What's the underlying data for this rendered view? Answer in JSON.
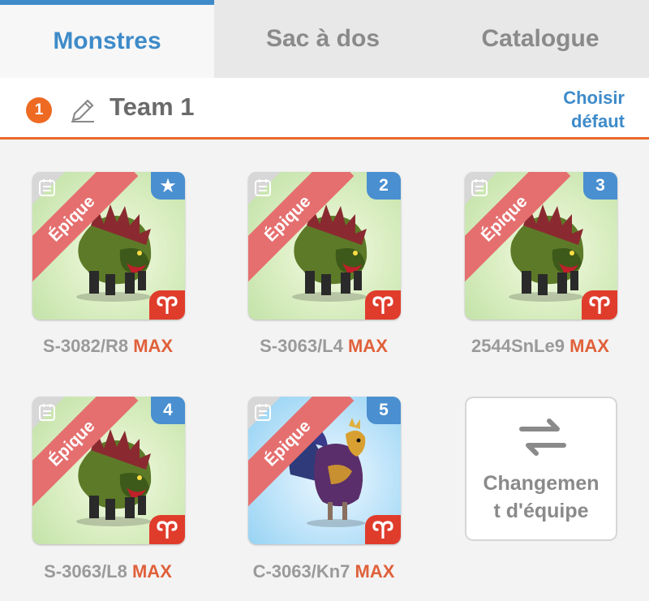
{
  "tabs": [
    {
      "label": "Monstres",
      "active": true
    },
    {
      "label": "Sac à dos",
      "active": false
    },
    {
      "label": "Catalogue",
      "active": false
    }
  ],
  "team": {
    "number": "1",
    "name": "Team 1",
    "choose_default": [
      "Choisir",
      "défaut"
    ]
  },
  "monsters": [
    {
      "rarity": "Épique",
      "slot": "★",
      "name": "S-3082/R8",
      "level": "MAX",
      "bg": "green",
      "kind": "dragon"
    },
    {
      "rarity": "Épique",
      "slot": "2",
      "name": "S-3063/L4",
      "level": "MAX",
      "bg": "green",
      "kind": "dragon"
    },
    {
      "rarity": "Épique",
      "slot": "3",
      "name": "2544SnLe9",
      "level": "MAX",
      "bg": "green",
      "kind": "dragon"
    },
    {
      "rarity": "Épique",
      "slot": "4",
      "name": "S-3063/L8",
      "level": "MAX",
      "bg": "green",
      "kind": "dragon"
    },
    {
      "rarity": "Épique",
      "slot": "5",
      "name": "C-3063/Kn7",
      "level": "MAX",
      "bg": "blue",
      "kind": "rooster"
    }
  ],
  "swap": {
    "label_lines": [
      "Changemen",
      "t d'équipe"
    ],
    "icon": "swap-arrows-icon"
  },
  "colors": {
    "accent_blue": "#3e8bc9",
    "accent_orange": "#ea6a2a",
    "epic_ribbon": "#e56f6f",
    "zodiac_red": "#e03c2c"
  }
}
